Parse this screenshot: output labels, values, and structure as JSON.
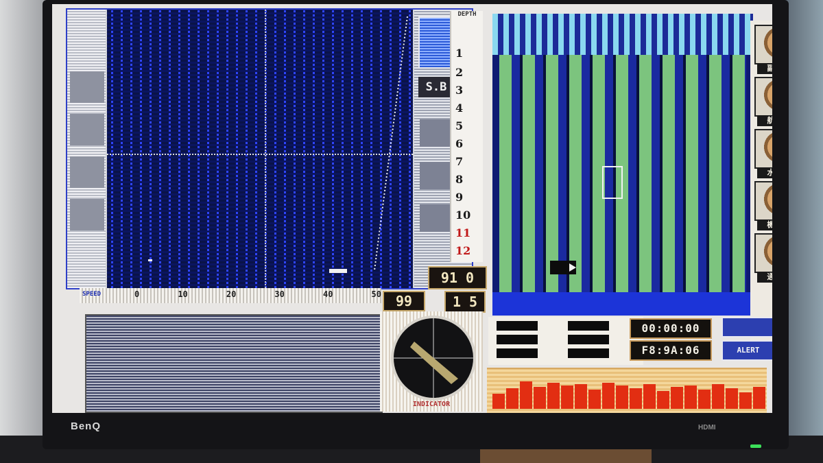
{
  "monitor": {
    "brand": "BenQ",
    "port_label": "HDMI"
  },
  "sonar": {
    "sb_label": "S.B",
    "speed_label": "SPEED",
    "speed_ticks": [
      "0",
      "10",
      "20",
      "30",
      "40",
      "50"
    ]
  },
  "depth_scale": {
    "title": "DEPTH",
    "marks": [
      "1",
      "2",
      "3",
      "4",
      "5",
      "6",
      "7",
      "8",
      "9",
      "10",
      "11",
      "12"
    ]
  },
  "counters": {
    "top": "91 0",
    "speed": "99",
    "right": "1 5"
  },
  "compass": {
    "label": "INDICATOR"
  },
  "crew": [
    {
      "name": "副艦長"
    },
    {
      "name": "航海長"
    },
    {
      "name": "水雷長"
    },
    {
      "name": "機関長"
    },
    {
      "name": "通信長"
    }
  ],
  "status": {
    "time": "00:00:00",
    "position": "F8:9A:06",
    "button": "ALERT"
  },
  "colors": {
    "field_green": "#7cc47e",
    "sonar_blue": "#2f45ff",
    "bar_red": "#e22e12"
  }
}
